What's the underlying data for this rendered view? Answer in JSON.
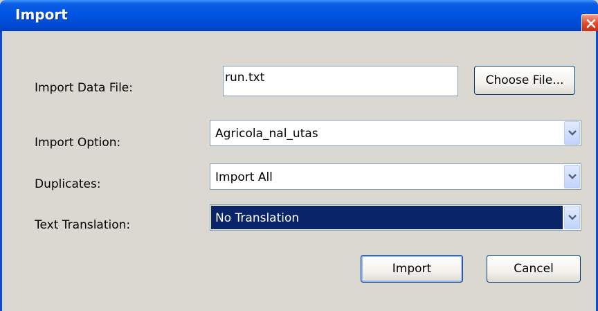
{
  "window": {
    "title": "Import"
  },
  "form": {
    "file": {
      "label": "Import Data File:",
      "value": "run.txt",
      "choose_button": "Choose File..."
    },
    "import_option": {
      "label": "Import Option:",
      "selected": "Agricola_nal_utas"
    },
    "duplicates": {
      "label": "Duplicates:",
      "selected": "Import All"
    },
    "text_translation": {
      "label": "Text Translation:",
      "selected": "No Translation"
    }
  },
  "actions": {
    "import_label": "Import",
    "cancel_label": "Cancel"
  },
  "icons": {
    "close": "close-icon",
    "dropdown": "chevron-down-icon"
  },
  "colors": {
    "titlebar": "#0054e3",
    "selection": "#0a246a",
    "close": "#e0482a"
  }
}
